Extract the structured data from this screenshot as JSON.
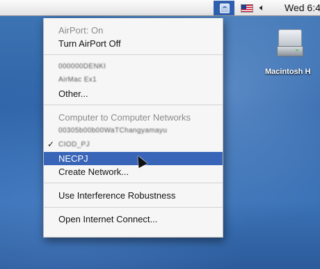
{
  "menubar": {
    "airport_icon": "airport-icon",
    "flag_icon": "flag-icon",
    "speaker_icon": "speaker-icon",
    "clock": "Wed 6:4"
  },
  "desktop": {
    "drive_icon": "hard-drive-icon",
    "drive_label": "Macintosh H"
  },
  "menu": {
    "airport_status": "AirPort: On",
    "turn_off": "Turn AirPort Off",
    "network_1": "000000DENKI",
    "network_2": "AirMac Ex1",
    "other": "Other...",
    "c2c_header": "Computer to Computer Networks",
    "c2c_network_1": "00305b00b00WaTChangyamayu",
    "checkmark": "✓",
    "c2c_network_2": "CIOD_PJ",
    "selected_network": "NECPJ",
    "create_network": "Create Network...",
    "interference": "Use Interference Robustness",
    "open_internet": "Open Internet Connect..."
  },
  "colors": {
    "selection": "#3865b8",
    "airport_highlight": "#2f5fae",
    "desktop": "#3a6fb2"
  }
}
